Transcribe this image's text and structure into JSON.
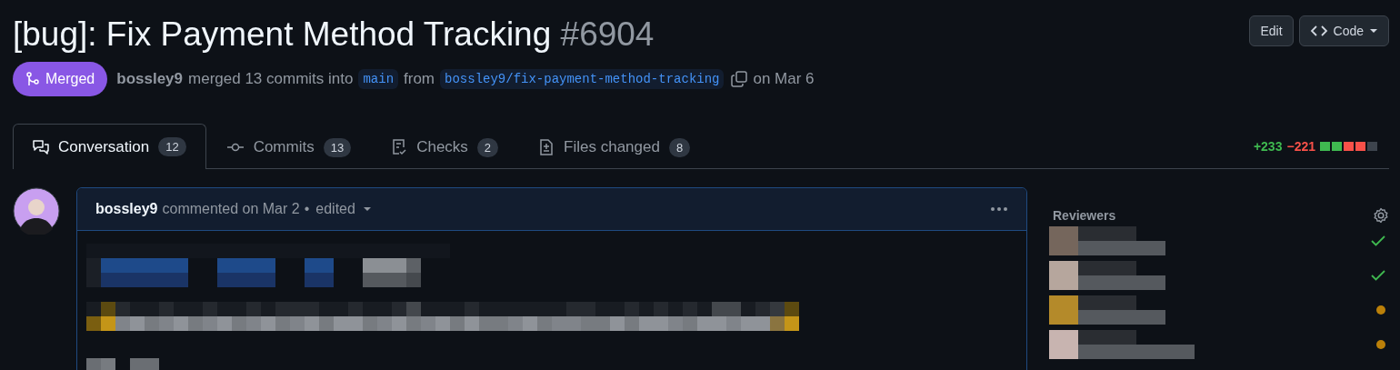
{
  "header": {
    "title": "[bug]: Fix Payment Method Tracking",
    "number": "#6904",
    "actions": [
      {
        "kind": "edit",
        "label": "Edit"
      },
      {
        "kind": "code",
        "label": "Code"
      }
    ]
  },
  "status": {
    "merged": true,
    "label": "Merged",
    "author": "bossley9",
    "text": "merged 13 commits into",
    "base": "main",
    "from": "from",
    "head": "bossley9/fix-payment-method-tracking",
    "date": "on Mar 6"
  },
  "tabs": [
    {
      "label": "Conversation",
      "count": "12",
      "selected": true
    },
    {
      "label": "Commits",
      "count": "13",
      "selected": false
    },
    {
      "label": "Checks",
      "count": "2",
      "selected": false
    },
    {
      "label": "Files changed",
      "count": "8",
      "selected": false
    }
  ],
  "diffstat": {
    "additions": "+233",
    "deletions": "−221",
    "blocks": [
      {
        "color": "#3fb950"
      },
      {
        "color": "#3fb950"
      },
      {
        "color": "#f85149"
      },
      {
        "color": "#f85149"
      },
      {
        "color": "#3d444d"
      }
    ]
  },
  "comment": {
    "author": "bossley9",
    "text": "commented on Mar 2",
    "separator": "•",
    "edited": "edited"
  },
  "sidebar": {
    "title": "Reviewers",
    "reviewers": [
      {
        "approved": true
      },
      {
        "approved": true
      },
      {
        "approved": false
      },
      {
        "approved": false
      }
    ]
  }
}
